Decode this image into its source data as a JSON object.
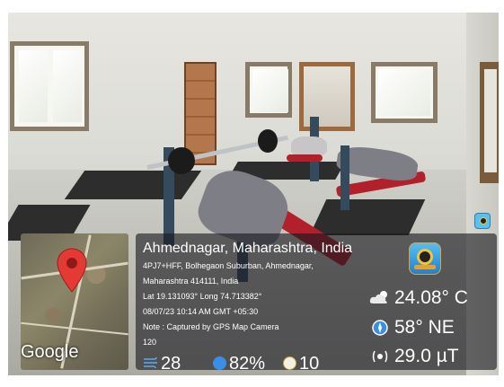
{
  "overlay": {
    "location_title": "Ahmednagar, Maharashtra, India",
    "address_line1": "4PJ7+HFF, Bolhegaon Suburban, Ahmednagar,",
    "address_line2": "Maharashtra 414111, India",
    "coordinates": "Lat 19.131093° Long 74.713382°",
    "datetime": "08/07/23 10:14 AM GMT +05:30",
    "note": "Note : Captured by GPS Map Camera",
    "altitude": "120",
    "temperature": "24.08° C",
    "wind_direction": "58° NE",
    "magnetic_field": "29.0 µT",
    "wind_speed": "28",
    "humidity": "82%",
    "pressure": "10",
    "map_brand": "Google"
  },
  "icons": {
    "map_pin": "map-pin-icon",
    "app": "gps-map-camera-app-icon",
    "weather": "cloud-sun-icon",
    "compass": "compass-icon",
    "magnet": "magnetic-field-icon",
    "wind": "wind-icon",
    "humidity": "humidity-icon",
    "pressure": "pressure-gauge-icon"
  },
  "colors": {
    "pin_red": "#e53935",
    "panel_bg": "rgba(25,25,30,0.62)",
    "app_blue": "#1e7fd1"
  }
}
